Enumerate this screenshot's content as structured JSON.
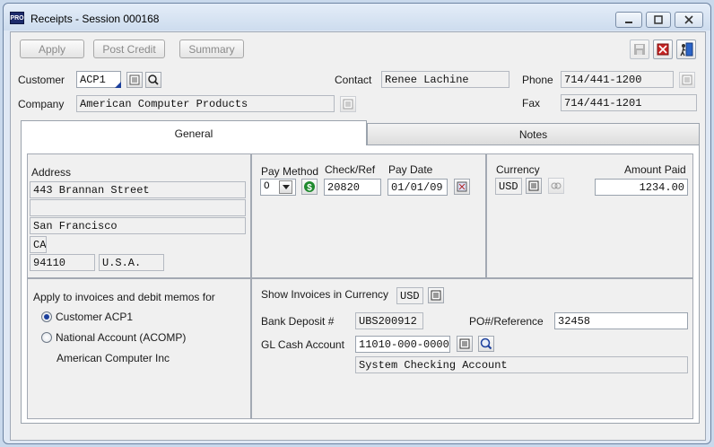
{
  "window": {
    "title": "Receipts - Session 000168",
    "app_badge": "PRO"
  },
  "toolbar": {
    "apply_label": "Apply",
    "post_credit_label": "Post Credit",
    "summary_label": "Summary"
  },
  "header": {
    "customer_label": "Customer",
    "customer_value": "ACP1",
    "company_label": "Company",
    "company_value": "American Computer Products",
    "contact_label": "Contact",
    "contact_value": "Renee Lachine",
    "phone_label": "Phone",
    "phone_value": "714/441-1200",
    "fax_label": "Fax",
    "fax_value": "714/441-1201"
  },
  "tabs": [
    {
      "label": "General",
      "active": true
    },
    {
      "label": "Notes",
      "active": false
    }
  ],
  "address": {
    "label": "Address",
    "line1": "443 Brannan Street",
    "line2": "",
    "city": "San Francisco",
    "state": "CA",
    "zip": "94110",
    "country": "U.S.A."
  },
  "payment": {
    "pay_method_label": "Pay Method",
    "pay_method_value": "O",
    "check_ref_label": "Check/Ref",
    "check_ref_value": "20820",
    "pay_date_label": "Pay Date",
    "pay_date_value": "01/01/09",
    "currency_label": "Currency",
    "currency_value": "USD",
    "amount_paid_label": "Amount Paid",
    "amount_paid_value": "1234.00"
  },
  "apply_to": {
    "label": "Apply to invoices and debit memos for",
    "option_customer": "Customer ACP1",
    "option_national": "National Account (ACOMP)",
    "national_name": "American Computer Inc",
    "selected": "customer"
  },
  "details": {
    "show_invoices_label": "Show Invoices in Currency",
    "show_invoices_value": "USD",
    "bank_deposit_label": "Bank Deposit #",
    "bank_deposit_value": "UBS200912",
    "po_label": "PO#/Reference",
    "po_value": "32458",
    "gl_cash_label": "GL Cash Account",
    "gl_cash_value": "11010-000-0000",
    "gl_cash_desc": "System Checking Account"
  },
  "colors": {
    "accent": "#1b3f9c",
    "dollar_green": "#1f8a2e"
  }
}
